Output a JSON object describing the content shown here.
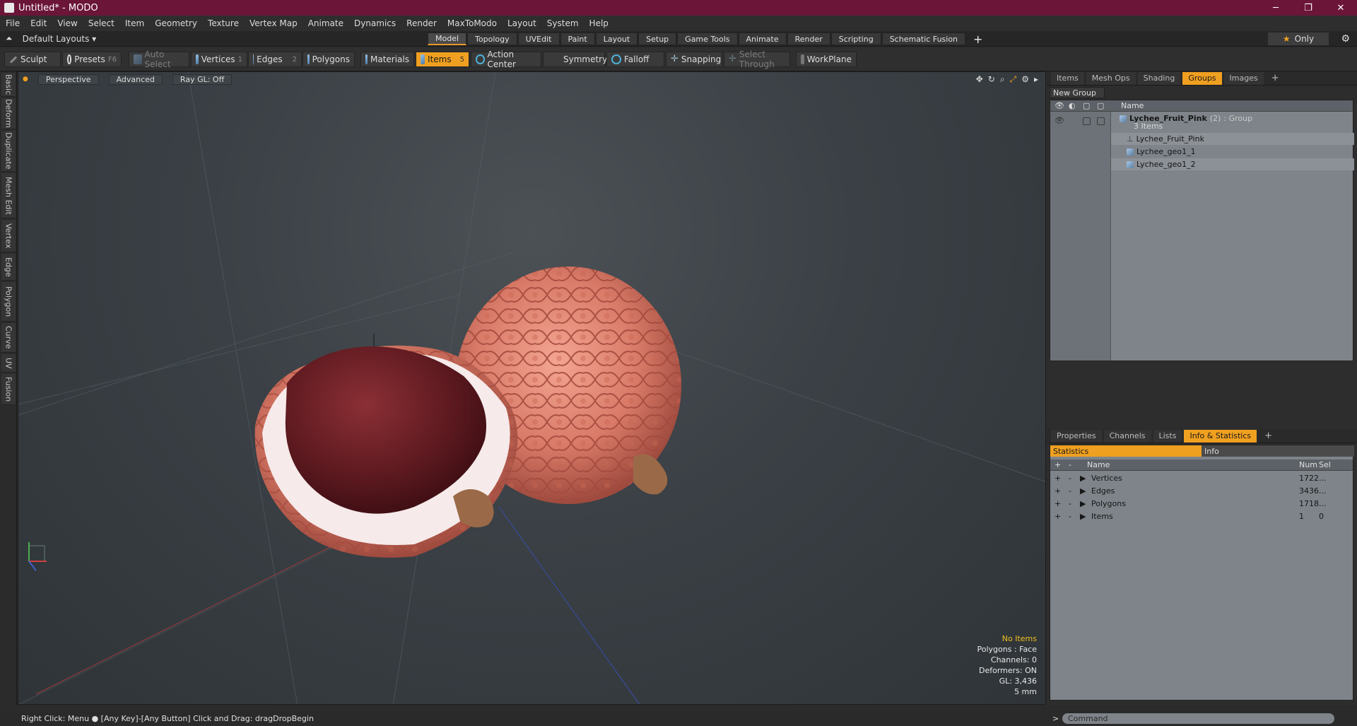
{
  "window": {
    "title": "Untitled* - MODO",
    "minimize": "─",
    "restore": "❐",
    "close": "✕"
  },
  "menubar": [
    "File",
    "Edit",
    "View",
    "Select",
    "Item",
    "Geometry",
    "Texture",
    "Vertex Map",
    "Animate",
    "Dynamics",
    "Render",
    "MaxToModo",
    "Layout",
    "System",
    "Help"
  ],
  "layouts": {
    "label": "Default Layouts ▾"
  },
  "mode_tabs": [
    {
      "label": "Model",
      "active": true
    },
    {
      "label": "Topology",
      "active": false
    },
    {
      "label": "UVEdit",
      "active": false
    },
    {
      "label": "Paint",
      "active": false
    },
    {
      "label": "Layout",
      "active": false
    },
    {
      "label": "Setup",
      "active": false
    },
    {
      "label": "Game Tools",
      "active": false
    },
    {
      "label": "Animate",
      "active": false
    },
    {
      "label": "Render",
      "active": false
    },
    {
      "label": "Scripting",
      "active": false
    },
    {
      "label": "Schematic Fusion",
      "active": false
    }
  ],
  "only": {
    "star": "★",
    "label": "Only"
  },
  "toolbar": {
    "sculpt": "Sculpt",
    "presets": "Presets",
    "presets_key": "F6",
    "auto_select": "Auto Select",
    "vertices": "Vertices",
    "vertices_key": "1",
    "edges": "Edges",
    "edges_key": "2",
    "polygons": "Polygons",
    "materials": "Materials",
    "items": "Items",
    "items_key": "5",
    "action_center": "Action Center",
    "symmetry": "Symmetry",
    "falloff": "Falloff",
    "snapping": "Snapping",
    "select_through": "Select Through",
    "workplane": "WorkPlane"
  },
  "left_tabs": [
    "Basic",
    "Deform",
    "Duplicate",
    "Mesh Edit",
    "Vertex",
    "Edge",
    "Polygon",
    "Curve",
    "UV",
    "Fusion"
  ],
  "viewport": {
    "perspective": "Perspective",
    "advanced": "Advanced",
    "raygl": "Ray GL: Off",
    "info": {
      "selection": "No Items",
      "polygons": "Polygons : Face",
      "channels": "Channels: 0",
      "deformers": "Deformers: ON",
      "gl": "GL: 3,436",
      "scale": "5 mm"
    }
  },
  "top_panel_tabs": [
    {
      "label": "Items",
      "active": false
    },
    {
      "label": "Mesh Ops",
      "active": false
    },
    {
      "label": "Shading",
      "active": false
    },
    {
      "label": "Groups",
      "active": true
    },
    {
      "label": "Images",
      "active": false
    }
  ],
  "groups": {
    "new_group": "New Group",
    "name_header": "Name",
    "root": {
      "name": "Lychee_Fruit_Pink",
      "count": "(2)",
      "type": ": Group",
      "sub": "3 Items"
    },
    "children": [
      "Lychee_Fruit_Pink",
      "Lychee_geo1_1",
      "Lychee_geo1_2"
    ]
  },
  "bottom_panel_tabs": [
    {
      "label": "Properties",
      "active": false
    },
    {
      "label": "Channels",
      "active": false
    },
    {
      "label": "Lists",
      "active": false
    },
    {
      "label": "Info & Statistics",
      "active": true
    }
  ],
  "stats": {
    "tab_statistics": "Statistics",
    "tab_info": "Info",
    "headers": {
      "name": "Name",
      "num": "Num",
      "sel": "Sel"
    },
    "rows": [
      {
        "name": "Vertices",
        "num": "1722",
        "sel": "..."
      },
      {
        "name": "Edges",
        "num": "3436",
        "sel": "..."
      },
      {
        "name": "Polygons",
        "num": "1718",
        "sel": "..."
      },
      {
        "name": "Items",
        "num": "1",
        "sel": "0"
      }
    ]
  },
  "statusbar": {
    "text": "Right Click: Menu ● [Any Key]-[Any Button] Click and Drag: dragDropBegin"
  },
  "command": {
    "prompt": ">",
    "placeholder": "Command"
  },
  "colors": {
    "accent": "#f0a020",
    "titlebar": "#6b1538",
    "lychee_skin": "#e58a78",
    "lychee_flesh": "#6a1e24"
  }
}
